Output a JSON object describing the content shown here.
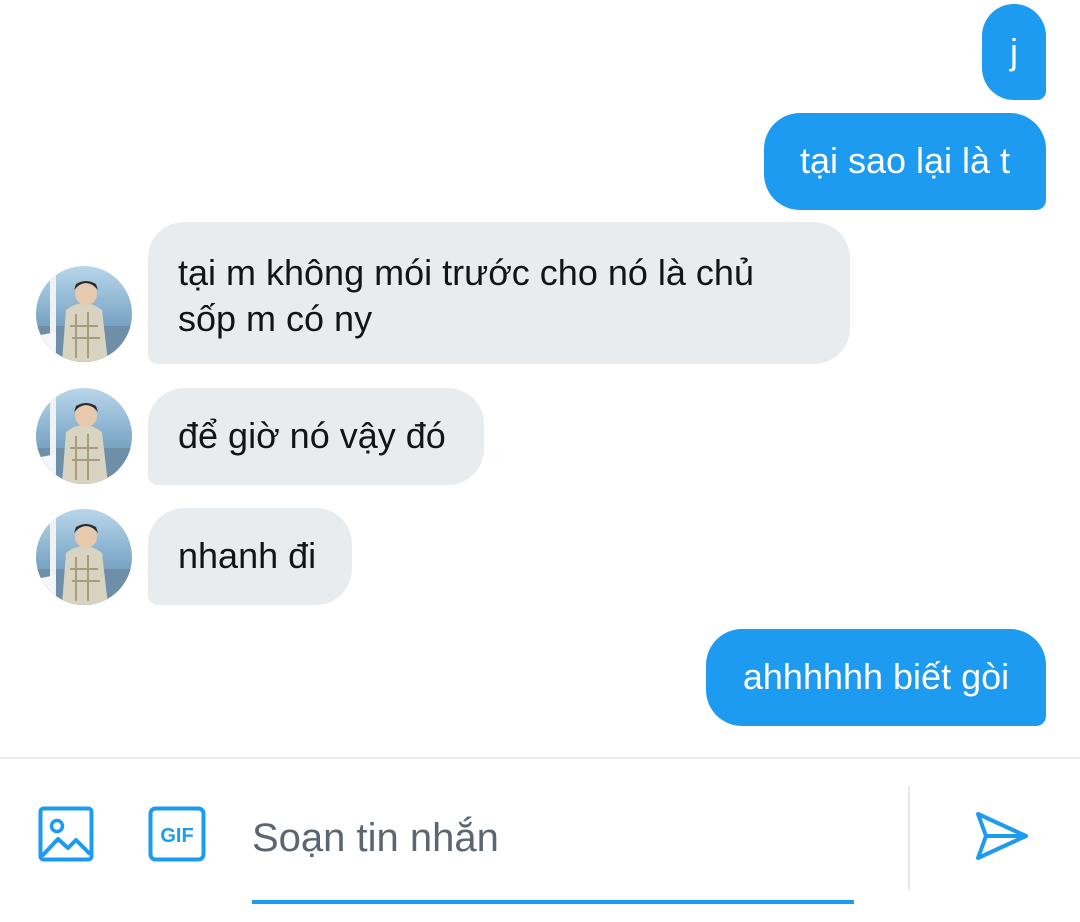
{
  "messages": [
    {
      "direction": "outgoing",
      "lines": [
        "j"
      ]
    },
    {
      "direction": "outgoing",
      "lines": [
        "tại sao lại là t"
      ]
    },
    {
      "direction": "incoming",
      "lines": [
        "tại m không mói trước cho nó là chủ",
        "sốp m có ny"
      ]
    },
    {
      "direction": "incoming",
      "lines": [
        "để giờ nó vậy đó"
      ]
    },
    {
      "direction": "incoming",
      "lines": [
        "nhanh đi"
      ]
    },
    {
      "direction": "outgoing",
      "lines": [
        "ahhhhhh biết gòi"
      ]
    }
  ],
  "composer": {
    "placeholder": "Soạn tin nhắn",
    "gif_label": "GIF",
    "icons": {
      "media": "image-icon",
      "gif": "gif-icon",
      "send": "send-icon"
    }
  },
  "colors": {
    "accent": "#1d9bf0",
    "incoming_bubble": "#e9ecef",
    "outgoing_text": "#ffffff",
    "incoming_text": "#111418"
  }
}
